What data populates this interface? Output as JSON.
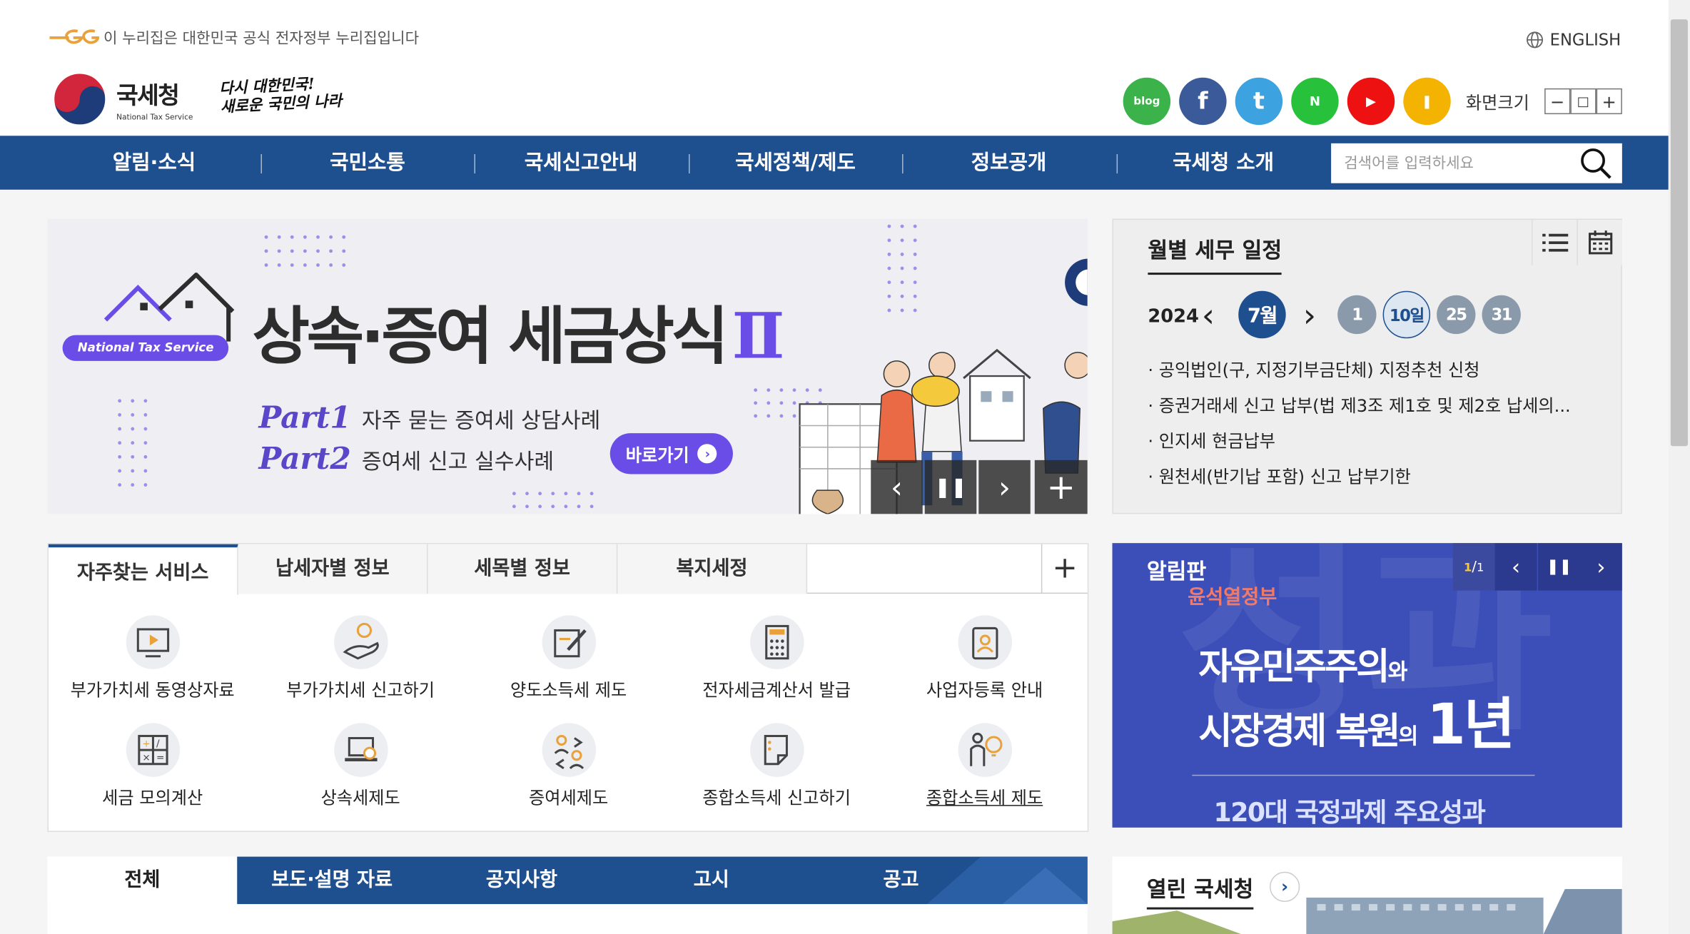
{
  "header": {
    "gov_notice": "이 누리집은 대한민국 공식 전자정부 누리집입니다",
    "english": "ENGLISH",
    "logo_kr": "국세청",
    "logo_en": "National Tax Service",
    "slogan_line1": "다시 대한민국!",
    "slogan_line2": "새로운 국민의 나라",
    "sns": [
      {
        "name": "blog-icon",
        "label": "blog",
        "color": "#3cb24a"
      },
      {
        "name": "facebook-icon",
        "label": "f",
        "color": "#3b5a9a"
      },
      {
        "name": "twitter-icon",
        "label": "t",
        "color": "#3da2e0"
      },
      {
        "name": "naver-post-icon",
        "label": "N",
        "color": "#27c13c"
      },
      {
        "name": "youtube-icon",
        "label": "▶",
        "color": "#ee1111"
      },
      {
        "name": "kakao-story-icon",
        "label": "❚",
        "color": "#f4b300"
      }
    ],
    "font_size_label": "화면크기",
    "font_minus": "−",
    "font_reset": "□",
    "font_plus": "+"
  },
  "gnb": {
    "items": [
      "알림·소식",
      "국민소통",
      "국세신고안내",
      "국세정책/제도",
      "정보공개",
      "국세청 소개"
    ],
    "search_placeholder": "검색어를 입력하세요"
  },
  "banner": {
    "pill": "National Tax Service",
    "title": "상속·증여 세금상식",
    "title_roman": "Ⅱ",
    "part1_label": "Part1",
    "part1_text": "자주 묻는 증여세 상담사례",
    "part2_label": "Part2",
    "part2_text": "증여세 신고 실수사례",
    "cta": "바로가기",
    "ctrl_prev": "‹",
    "ctrl_pause": "❚❚",
    "ctrl_next": "›",
    "ctrl_plus": "+",
    "accent_color": "#6a4de6"
  },
  "schedule": {
    "title": "월별 세무 일정",
    "year": "2024",
    "month": "7월",
    "prev": "‹",
    "next": "›",
    "days": [
      "1",
      "10일",
      "25",
      "31"
    ],
    "active_day_index": 1,
    "items": [
      "공익법인(구, 지정기부금단체) 지정추천 신청",
      "증권거래세 신고 납부(법 제3조 제1호 및 제2호 납세의...",
      "인지세 현금납부",
      "원천세(반기납 포함) 신고 납부기한"
    ]
  },
  "services": {
    "tabs": [
      "자주찾는 서비스",
      "납세자별 정보",
      "세목별 정보",
      "복지세정"
    ],
    "plus": "+",
    "items": [
      {
        "label": "부가가치세 동영상자료",
        "icon": "video-icon"
      },
      {
        "label": "부가가치세 신고하기",
        "icon": "hand-person-icon"
      },
      {
        "label": "양도소득세 제도",
        "icon": "pen-document-icon"
      },
      {
        "label": "전자세금계산서 발급",
        "icon": "calculator-icon"
      },
      {
        "label": "사업자등록 안내",
        "icon": "id-card-icon"
      },
      {
        "label": "세금 모의계산",
        "icon": "math-grid-icon"
      },
      {
        "label": "상속세제도",
        "icon": "laptop-icon"
      },
      {
        "label": "증여세제도",
        "icon": "exchange-people-icon"
      },
      {
        "label": "종합소득세 신고하기",
        "icon": "note-icon"
      },
      {
        "label": "종합소득세 제도",
        "icon": "person-bulb-icon"
      }
    ]
  },
  "board": {
    "title": "알림판",
    "page_current": "1",
    "page_total": "1",
    "prev": "‹",
    "pause": "❚❚",
    "next": "›",
    "sub": "윤석열정부",
    "line1_a": "자유민주주의",
    "line1_b": "와",
    "line2_a": "시장경제 복원",
    "line2_b": "의",
    "line2_c": "1년",
    "bottom": "120대 국정과제 주요성과"
  },
  "news": {
    "tabs": [
      "전체",
      "보도·설명 자료",
      "공지사항",
      "고시",
      "공고"
    ]
  },
  "open_nts": {
    "title": "열린 국세청",
    "arrow": "›"
  },
  "colors": {
    "primary": "#1e4f8f",
    "board_bg": "#3c4fb8"
  }
}
